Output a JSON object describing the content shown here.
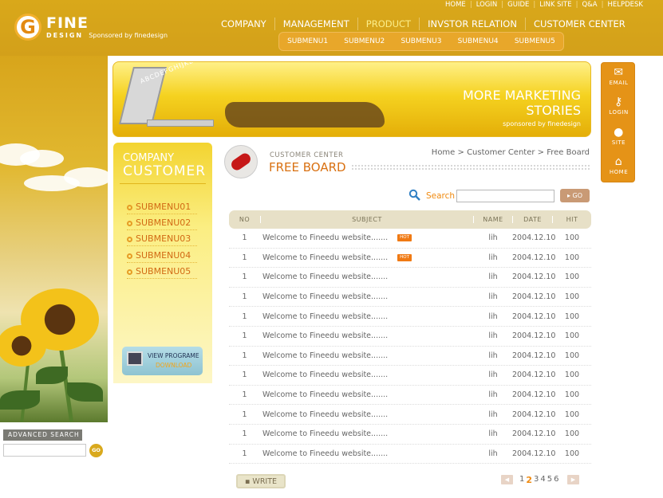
{
  "brand": {
    "logo_letter": "G",
    "name": "FINE",
    "sub": "DESIGN",
    "sponsor": "Sponsored by finedesign"
  },
  "utility_links": [
    "HOME",
    "LOGIN",
    "GUIDE",
    "LINK SITE",
    "Q&A",
    "HELPDESK"
  ],
  "main_nav": [
    {
      "label": "COMPANY",
      "active": false
    },
    {
      "label": "MANAGEMENT",
      "active": false
    },
    {
      "label": "PRODUCT",
      "active": true
    },
    {
      "label": "INVSTOR RELATION",
      "active": false
    },
    {
      "label": "CUSTOMER CENTER",
      "active": false
    }
  ],
  "sub_nav": [
    "SUBMENU1",
    "SUBMENU2",
    "SUBMENU3",
    "SUBMENU4",
    "SUBMENU5"
  ],
  "banner": {
    "title_line1": "MORE MARKETING",
    "title_line2": "STORIES",
    "sponsor": "sponsored by finedesign",
    "letters": "ABCDEFGHIJKLMNOPQRSTUVWXYZ"
  },
  "quick_menu": [
    {
      "label": "EMAIL",
      "icon": "envelope-icon"
    },
    {
      "label": "LOGIN",
      "icon": "key-icon"
    },
    {
      "label": "SITE",
      "icon": "globe-icon"
    },
    {
      "label": "HOME",
      "icon": "house-icon"
    }
  ],
  "left_menu": {
    "title1": "COMPANY",
    "title2": "CUSTOMER",
    "items": [
      "SUBMENU01",
      "SUBMENU02",
      "SUBMENU03",
      "SUBMENU04",
      "SUBMENU05"
    ],
    "download_label1": "VIEW PROGRAME",
    "download_label2": "DOWNLOAD"
  },
  "advanced_search": {
    "label": "ADVANCED SEARCH",
    "go": "GO"
  },
  "page": {
    "section": "CUSTOMER CENTER",
    "title": "FREE BOARD",
    "breadcrumb": "Home > Customer Center > Free Board"
  },
  "search": {
    "label": "Search",
    "value": "",
    "go": "GO"
  },
  "board": {
    "columns": {
      "no": "NO",
      "subject": "SUBJECT",
      "name": "NAME",
      "date": "DATE",
      "hit": "HIT"
    },
    "hot_label": "HOT",
    "rows": [
      {
        "no": "1",
        "subject": "Welcome to Fineedu website.......",
        "name": "lih",
        "date": "2004.12.10",
        "hit": "100",
        "hot": true
      },
      {
        "no": "1",
        "subject": "Welcome to Fineedu website.......",
        "name": "lih",
        "date": "2004.12.10",
        "hit": "100",
        "hot": true
      },
      {
        "no": "1",
        "subject": "Welcome to Fineedu website.......",
        "name": "lih",
        "date": "2004.12.10",
        "hit": "100",
        "hot": false
      },
      {
        "no": "1",
        "subject": "Welcome to Fineedu website.......",
        "name": "lih",
        "date": "2004.12.10",
        "hit": "100",
        "hot": false
      },
      {
        "no": "1",
        "subject": "Welcome to Fineedu website.......",
        "name": "lih",
        "date": "2004.12.10",
        "hit": "100",
        "hot": false
      },
      {
        "no": "1",
        "subject": "Welcome to Fineedu website.......",
        "name": "lih",
        "date": "2004.12.10",
        "hit": "100",
        "hot": false
      },
      {
        "no": "1",
        "subject": "Welcome to Fineedu website.......",
        "name": "lih",
        "date": "2004.12.10",
        "hit": "100",
        "hot": false
      },
      {
        "no": "1",
        "subject": "Welcome to Fineedu website.......",
        "name": "lih",
        "date": "2004.12.10",
        "hit": "100",
        "hot": false
      },
      {
        "no": "1",
        "subject": "Welcome to Fineedu website.......",
        "name": "lih",
        "date": "2004.12.10",
        "hit": "100",
        "hot": false
      },
      {
        "no": "1",
        "subject": "Welcome to Fineedu website.......",
        "name": "lih",
        "date": "2004.12.10",
        "hit": "100",
        "hot": false
      },
      {
        "no": "1",
        "subject": "Welcome to Fineedu website.......",
        "name": "lih",
        "date": "2004.12.10",
        "hit": "100",
        "hot": false
      },
      {
        "no": "1",
        "subject": "Welcome to Fineedu website.......",
        "name": "lih",
        "date": "2004.12.10",
        "hit": "100",
        "hot": false
      }
    ]
  },
  "write_label": "WRITE",
  "pagination": {
    "pages": [
      "1",
      "2",
      "3",
      "4",
      "5",
      "6"
    ],
    "current": "2"
  },
  "colors": {
    "brand_gold": "#d9a81a",
    "accent_orange": "#f08b12",
    "hot_badge": "#f07a14"
  }
}
